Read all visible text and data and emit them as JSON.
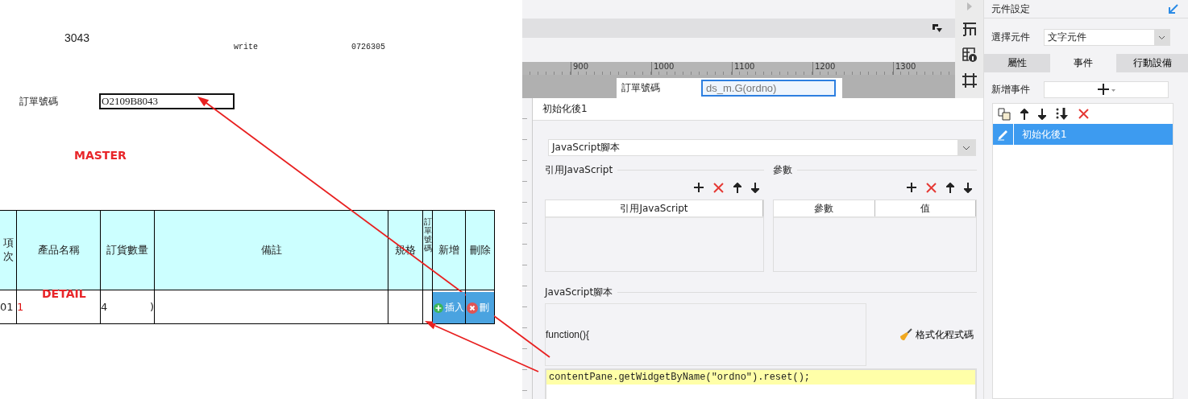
{
  "report": {
    "fragment": "3043",
    "write_label": "write",
    "number": "0726305",
    "order_label": "訂單號碼",
    "order_value": "O2109B8043",
    "master_label": "MASTER",
    "detail_label": "DETAIL",
    "columns": [
      "項次",
      "產品名稱",
      "訂貨數量",
      "備註",
      "規格",
      "訂單號碼",
      "新增",
      "刪除"
    ],
    "row": [
      {
        "kind": "text",
        "text": "01"
      },
      {
        "kind": "text",
        "text": "1"
      },
      {
        "kind": "split",
        "parts": [
          "4",
          ")"
        ]
      },
      {
        "kind": "empty"
      },
      {
        "kind": "empty"
      },
      {
        "kind": "empty"
      },
      {
        "kind": "add",
        "text": "插入"
      },
      {
        "kind": "remove",
        "text": "刪"
      }
    ]
  },
  "designer": {
    "ruler_marks": [
      "900",
      "1000",
      "1100",
      "1200",
      "1300"
    ],
    "cell_label": "訂單號碼",
    "cell_field": "ds_m.G(ordno)"
  },
  "dialog": {
    "title": "初始化後1",
    "type_select": "JavaScript腳本",
    "refs_title": "引用JavaScript",
    "refs_columns": [
      "引用JavaScript"
    ],
    "params_title": "參數",
    "params_columns": [
      "參數",
      "值"
    ],
    "script_title": "JavaScript腳本",
    "function_header": "function(){",
    "format_button": "格式化程式碼",
    "code_line": "contentPane.getWidgetByName(\"ordno\").reset();"
  },
  "panel": {
    "title": "元件設定",
    "select_label": "選擇元件",
    "select_value": "文字元件",
    "tabs": [
      {
        "label": "屬性",
        "selected": false
      },
      {
        "label": "事件",
        "selected": true
      },
      {
        "label": "行動設備",
        "selected": false
      }
    ],
    "add_event_label": "新增事件",
    "events": [
      {
        "label": "初始化後1",
        "selected": true
      }
    ]
  }
}
